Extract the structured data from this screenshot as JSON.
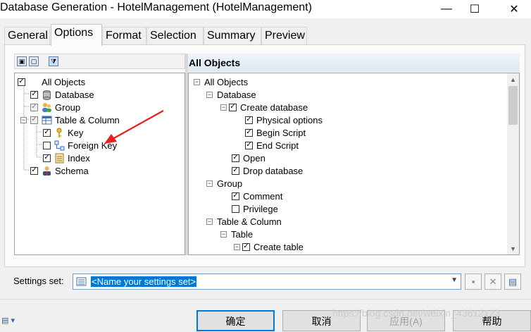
{
  "window": {
    "title": "Database Generation - HotelManagement (HotelManagement)",
    "minimize_glyph": "—",
    "maximize_glyph": "☐",
    "close_glyph": "✕"
  },
  "tabs": [
    {
      "label": "General"
    },
    {
      "label": "Options",
      "active": true
    },
    {
      "label": "Format"
    },
    {
      "label": "Selection"
    },
    {
      "label": "Summary"
    },
    {
      "label": "Preview"
    }
  ],
  "left_tree": {
    "items": [
      {
        "label": "All Objects",
        "checked": true,
        "icon": "none"
      },
      {
        "label": "Database",
        "checked": true,
        "icon": "database-icon"
      },
      {
        "label": "Group",
        "checked": true,
        "icon": "group-icon"
      },
      {
        "label": "Table & Column",
        "checked": true,
        "icon": "table-icon"
      },
      {
        "label": "Key",
        "checked": true,
        "icon": "key-icon"
      },
      {
        "label": "Foreign Key",
        "checked": false,
        "icon": "foreign-key-icon"
      },
      {
        "label": "Index",
        "checked": true,
        "icon": "index-icon"
      },
      {
        "label": "Schema",
        "checked": true,
        "icon": "schema-icon"
      }
    ]
  },
  "right_panel": {
    "header": "All Objects",
    "items": [
      {
        "label": "All Objects",
        "expanded": true,
        "checkbox": false
      },
      {
        "label": "Database",
        "expanded": true,
        "checkbox": false
      },
      {
        "label": "Create database",
        "expanded": true,
        "checkbox": true,
        "checked": true
      },
      {
        "label": "Physical options",
        "checkbox": true,
        "checked": true
      },
      {
        "label": "Begin Script",
        "checkbox": true,
        "checked": true
      },
      {
        "label": "End Script",
        "checkbox": true,
        "checked": true
      },
      {
        "label": "Open",
        "checkbox": true,
        "checked": true
      },
      {
        "label": "Drop database",
        "checkbox": true,
        "checked": true
      },
      {
        "label": "Group",
        "expanded": true,
        "checkbox": false
      },
      {
        "label": "Comment",
        "checkbox": true,
        "checked": true
      },
      {
        "label": "Privilege",
        "checkbox": true,
        "checked": false
      },
      {
        "label": "Table & Column",
        "expanded": true,
        "checkbox": false
      },
      {
        "label": "Table",
        "expanded": true,
        "checkbox": false
      },
      {
        "label": "Create table",
        "expanded": true,
        "checkbox": true,
        "checked": true
      }
    ]
  },
  "settings": {
    "label": "Settings set:",
    "value": "<Name your settings set>"
  },
  "buttons": {
    "ok": "确定",
    "cancel": "取消",
    "apply": "应用(A)",
    "help": "帮助"
  },
  "watermark": "https://blog.csdn.net/weixin_43612123",
  "colors": {
    "accent": "#0078d7",
    "annotation_arrow": "#e8201e"
  }
}
